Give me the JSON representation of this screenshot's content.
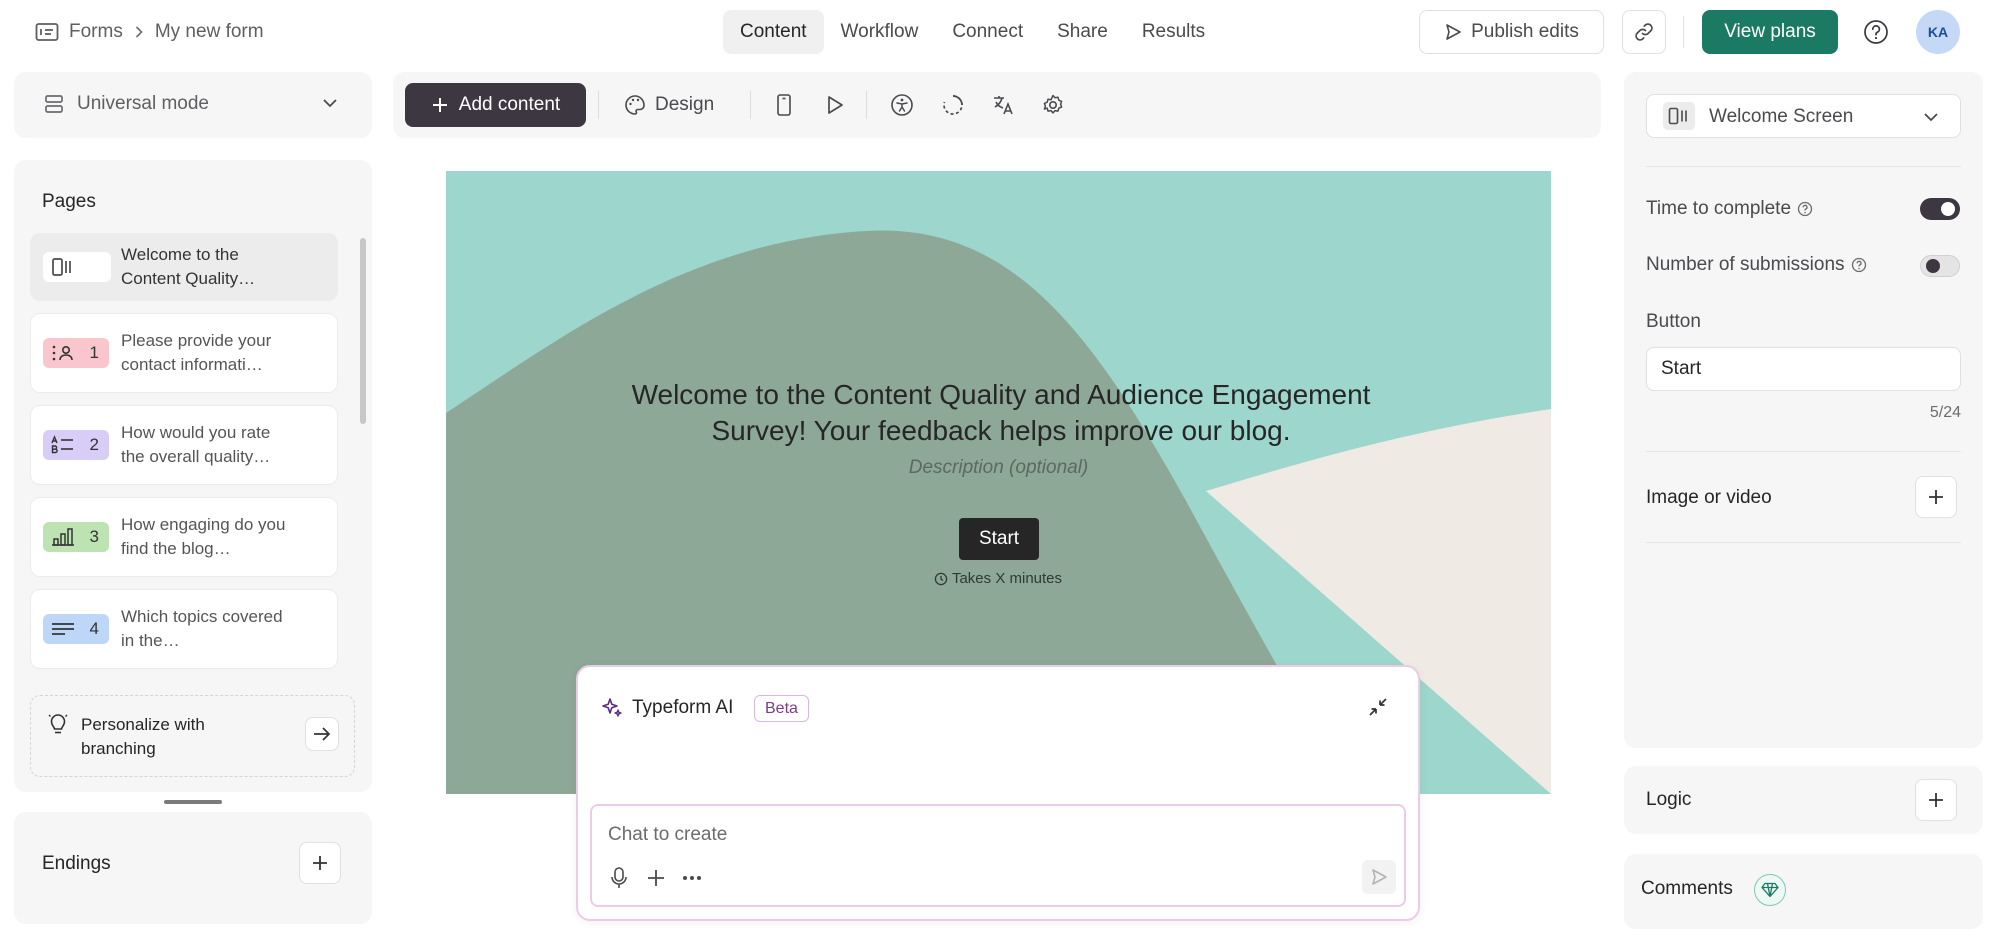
{
  "breadcrumb": {
    "root": "Forms",
    "current": "My new form"
  },
  "nav_tabs": [
    "Content",
    "Workflow",
    "Connect",
    "Share",
    "Results"
  ],
  "header": {
    "publish_label": "Publish edits",
    "plans_label": "View plans",
    "avatar_initials": "KA"
  },
  "sidebar": {
    "mode_label": "Universal mode",
    "pages_title": "Pages",
    "pages": [
      {
        "number": "",
        "text": "Welcome to the Content Quality…",
        "color": "#dedede"
      },
      {
        "number": "1",
        "text": "Please provide your contact informati…",
        "color": "#f9c6ce"
      },
      {
        "number": "2",
        "text": "How would you rate the overall quality…",
        "color": "#d7cdf6"
      },
      {
        "number": "3",
        "text": "How engaging do you find the blog…",
        "color": "#bde3b2"
      },
      {
        "number": "4",
        "text": "Which topics covered in the…",
        "color": "#bed6f7"
      }
    ],
    "branching_label": "Personalize with branching",
    "endings_title": "Endings"
  },
  "toolbar": {
    "add_content_label": "Add content",
    "design_label": "Design"
  },
  "canvas": {
    "title": "Welcome to the Content Quality and Audience Engagement Survey! Your feedback helps improve our blog.",
    "description": "Description (optional)",
    "button_label": "Start",
    "time_note": "Takes X minutes",
    "colors": {
      "teal": "#9dd6cc",
      "olive": "#8ea897",
      "beige": "#efebe4"
    }
  },
  "ai_panel": {
    "title": "Typeform AI",
    "badge": "Beta",
    "placeholder": "Chat to create"
  },
  "settings": {
    "screen_type": "Welcome Screen",
    "time_to_complete_label": "Time to complete",
    "time_to_complete_on": true,
    "submissions_label": "Number of submissions",
    "submissions_on": false,
    "button_section_label": "Button",
    "button_value": "Start",
    "char_count": "5/24",
    "image_label": "Image or video",
    "logic_label": "Logic",
    "comments_label": "Comments"
  }
}
